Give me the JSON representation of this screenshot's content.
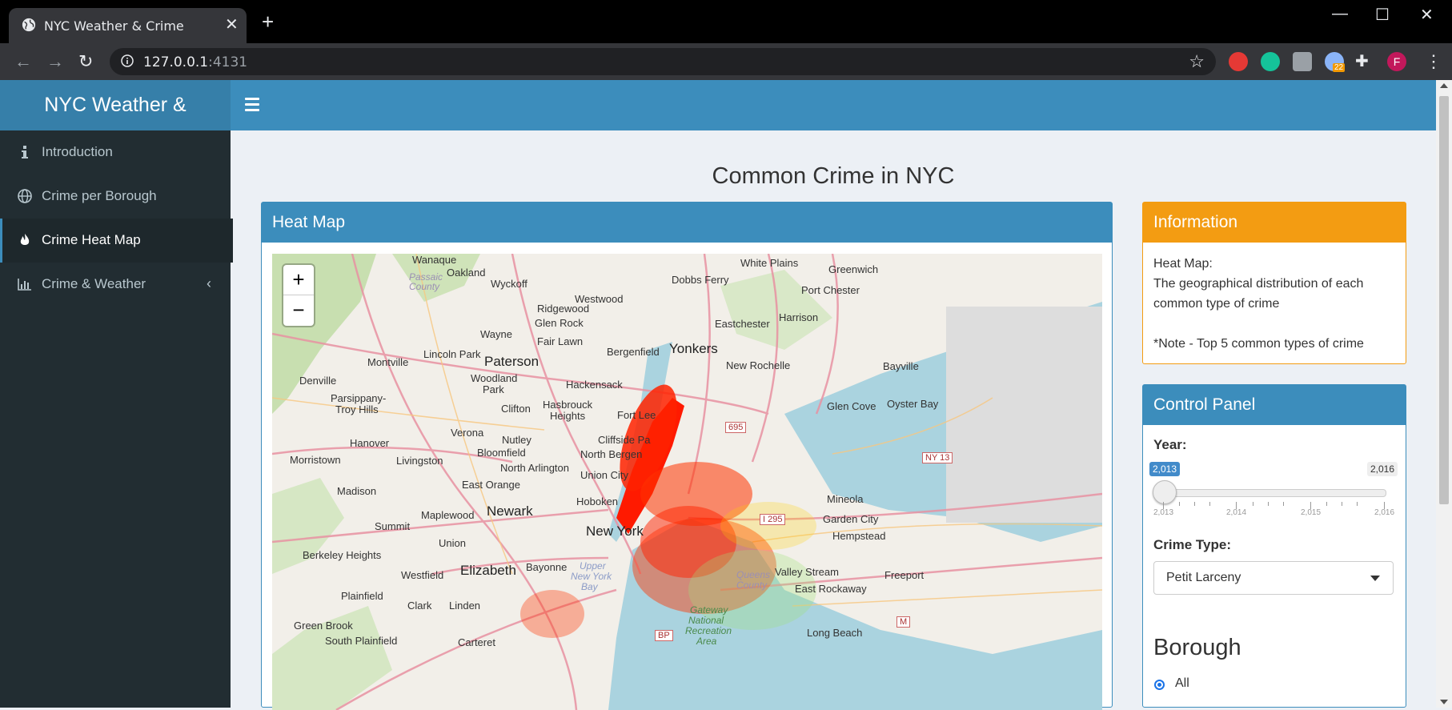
{
  "browser": {
    "tab_title": "NYC Weather & Crime",
    "url_host": "127.0.0.1",
    "url_port": ":4131",
    "profile_initial": "F",
    "extension_badge": "22"
  },
  "app": {
    "logo_text": "NYC Weather &",
    "sidebar": [
      {
        "label": "Introduction",
        "icon": "info-icon"
      },
      {
        "label": "Crime per Borough",
        "icon": "globe-icon"
      },
      {
        "label": "Crime Heat Map",
        "icon": "fire-icon",
        "active": true
      },
      {
        "label": "Crime & Weather",
        "icon": "bar-chart-icon",
        "has_submenu": true
      }
    ],
    "page_title": "Common Crime in NYC",
    "heatmap": {
      "title": "Heat Map",
      "zoom_in": "+",
      "zoom_out": "−",
      "labels": {
        "wanaque": "Wanaque",
        "oakland": "Oakland",
        "passaic": "Passaic",
        "county": "County",
        "wyckoff": "Wyckoff",
        "ridgewood": "Ridgewood",
        "westwood": "Westwood",
        "dobbs_ferry": "Dobbs Ferry",
        "white_plains": "White Plains",
        "greenwich": "Greenwich",
        "port_chester": "Port Chester",
        "harrison": "Harrison",
        "eastchester": "Eastchester",
        "glen_rock": "Glen Rock",
        "fair_lawn": "Fair Lawn",
        "wayne": "Wayne",
        "yonkers": "Yonkers",
        "bergenfield": "Bergenfield",
        "new_rochelle": "New Rochelle",
        "bayville": "Bayville",
        "montville": "Montville",
        "lincoln_park": "Lincoln Park",
        "paterson": "Paterson",
        "woodland": "Woodland",
        "park": "Park",
        "denville": "Denville",
        "hackensack": "Hackensack",
        "parsippany": "Parsippany-",
        "troy_hills": "Troy Hills",
        "clifton": "Clifton",
        "hasbrouck": "Hasbrouck",
        "heights": "Heights",
        "fort_lee": "Fort Lee",
        "glen_cove": "Glen Cove",
        "oyster_bay": "Oyster Bay",
        "verona": "Verona",
        "hanover": "Hanover",
        "nutley": "Nutley",
        "cliffside": "Cliffside Pa",
        "bloomfield": "Bloomfield",
        "morristown": "Morristown",
        "livingston": "Livingston",
        "north_bergen": "North Bergen",
        "north_arlington": "North Arlington",
        "union_city": "Union City",
        "madison": "Madison",
        "east_orange": "East Orange",
        "hoboken": "Hoboken",
        "mineola": "Mineola",
        "maplewood": "Maplewood",
        "newark": "Newark",
        "garden_city": "Garden City",
        "summit": "Summit",
        "new_york": "New York",
        "hempstead": "Hempstead",
        "union": "Union",
        "berkeley_heights": "Berkeley Heights",
        "elizabeth": "Elizabeth",
        "bayonne": "Bayonne",
        "upper": "Upper",
        "new_york_bay": "New York",
        "bay": "Bay",
        "valley_stream": "Valley Stream",
        "freeport": "Freeport",
        "westfield": "Westfield",
        "queens": "Queens",
        "county2": "County",
        "east_rockaway": "East Rockaway",
        "plainfield": "Plainfield",
        "clark": "Clark",
        "linden": "Linden",
        "gateway": "Gateway",
        "national": "National",
        "recreation": "Recreation",
        "area": "Area",
        "green_brook": "Green Brook",
        "long_beach": "Long Beach",
        "south_plainfield": "South Plainfield",
        "carteret": "Carteret",
        "shield_695": "695",
        "shield_ny13": "NY 13",
        "shield_i295": "I 295",
        "shield_m": "M",
        "shield_bp": "BP"
      }
    },
    "information": {
      "title": "Information",
      "line1": "Heat Map:",
      "line2": "The geographical distribution of each common type of crime",
      "line3": "*Note - Top 5 common types of crime"
    },
    "control_panel": {
      "title": "Control Panel",
      "year_label": "Year:",
      "year_value": "2,013",
      "year_max": "2,016",
      "year_ticks": [
        "2,013",
        "2,014",
        "2,015",
        "2,016"
      ],
      "crime_type_label": "Crime Type:",
      "crime_type_value": "Petit Larceny",
      "borough_title": "Borough",
      "borough_option": "All"
    }
  },
  "colors": {
    "header_blue": "#3c8dbc",
    "logo_blue": "#367fa9",
    "sidebar_dark": "#222d32",
    "info_orange": "#f39c12"
  }
}
